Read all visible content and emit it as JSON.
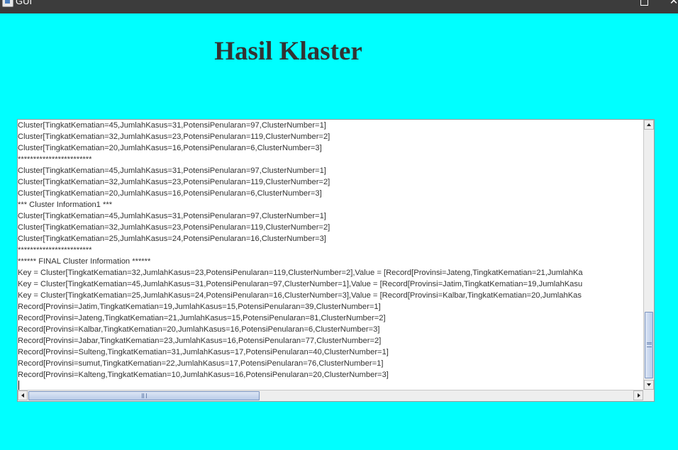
{
  "window": {
    "title": "GUI",
    "minimize_glyph": "–",
    "close_glyph": "✕"
  },
  "heading": "Hasil Klaster",
  "output_lines": [
    "Cluster[TingkatKematian=45,JumlahKasus=31,PotensiPenularan=97,ClusterNumber=1]",
    "Cluster[TingkatKematian=32,JumlahKasus=23,PotensiPenularan=119,ClusterNumber=2]",
    "Cluster[TingkatKematian=20,JumlahKasus=16,PotensiPenularan=6,ClusterNumber=3]",
    "************************",
    "Cluster[TingkatKematian=45,JumlahKasus=31,PotensiPenularan=97,ClusterNumber=1]",
    "Cluster[TingkatKematian=32,JumlahKasus=23,PotensiPenularan=119,ClusterNumber=2]",
    "Cluster[TingkatKematian=20,JumlahKasus=16,PotensiPenularan=6,ClusterNumber=3]",
    "*** Cluster Information1 ***",
    "Cluster[TingkatKematian=45,JumlahKasus=31,PotensiPenularan=97,ClusterNumber=1]",
    "Cluster[TingkatKematian=32,JumlahKasus=23,PotensiPenularan=119,ClusterNumber=2]",
    "Cluster[TingkatKematian=25,JumlahKasus=24,PotensiPenularan=16,ClusterNumber=3]",
    "************************",
    "****** FINAL Cluster Information ******",
    "Key = Cluster[TingkatKematian=32,JumlahKasus=23,PotensiPenularan=119,ClusterNumber=2],Value = [Record[Provinsi=Jateng,TingkatKematian=21,JumlahKa",
    "Key = Cluster[TingkatKematian=45,JumlahKasus=31,PotensiPenularan=97,ClusterNumber=1],Value = [Record[Provinsi=Jatim,TingkatKematian=19,JumlahKasu",
    "Key = Cluster[TingkatKematian=25,JumlahKasus=24,PotensiPenularan=16,ClusterNumber=3],Value = [Record[Provinsi=Kalbar,TingkatKematian=20,JumlahKas",
    "Record[Provinsi=Jatim,TingkatKematian=19,JumlahKasus=15,PotensiPenularan=39,ClusterNumber=1]",
    "Record[Provinsi=Jateng,TingkatKematian=21,JumlahKasus=15,PotensiPenularan=81,ClusterNumber=2]",
    "Record[Provinsi=Kalbar,TingkatKematian=20,JumlahKasus=16,PotensiPenularan=6,ClusterNumber=3]",
    "Record[Provinsi=Jabar,TingkatKematian=23,JumlahKasus=16,PotensiPenularan=77,ClusterNumber=2]",
    "Record[Provinsi=Sulteng,TingkatKematian=31,JumlahKasus=17,PotensiPenularan=40,ClusterNumber=1]",
    "Record[Provinsi=sumut,TingkatKematian=22,JumlahKasus=17,PotensiPenularan=76,ClusterNumber=1]",
    "Record[Provinsi=Kalteng,TingkatKematian=10,JumlahKasus=16,PotensiPenularan=20,ClusterNumber=3]"
  ],
  "colors": {
    "background": "#00FFFF",
    "titlebar": "#3C3C3C",
    "heading_text": "#333333"
  }
}
